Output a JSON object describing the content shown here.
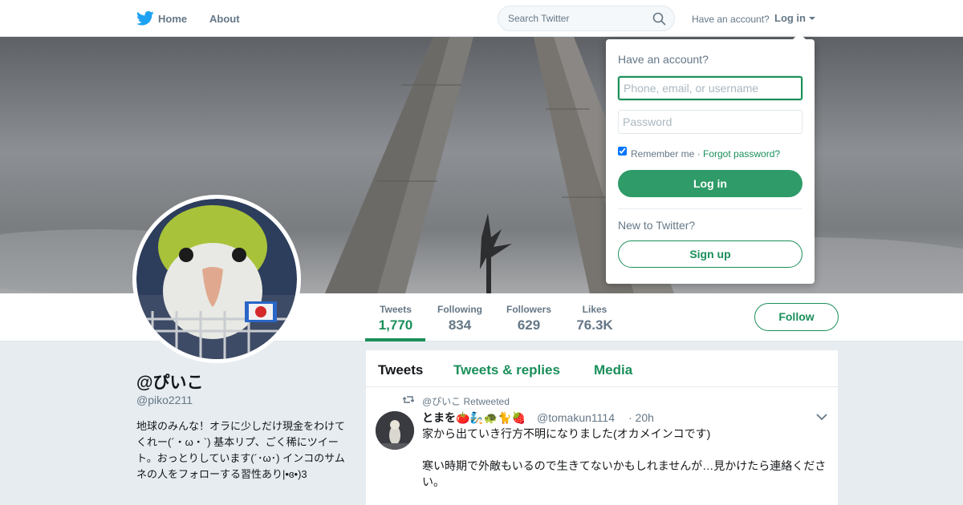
{
  "nav": {
    "home": "Home",
    "about": "About",
    "search_placeholder": "Search Twitter",
    "have_account": "Have an account?",
    "login": "Log in"
  },
  "profile": {
    "name": "@ぴいこ",
    "handle": "@piko2211",
    "bio": "地球のみんな！オラに少しだけ現金をわけてくれー(´・ω・`) 基本リプ、ごく稀にツイート。おっとりしています(´･ω･) インコのサムネの人をフォローする習性あり|•ɞ•)3"
  },
  "stats": [
    {
      "label": "Tweets",
      "value": "1,770",
      "active": true
    },
    {
      "label": "Following",
      "value": "834",
      "active": false
    },
    {
      "label": "Followers",
      "value": "629",
      "active": false
    },
    {
      "label": "Likes",
      "value": "76.3K",
      "active": false
    }
  ],
  "follow_label": "Follow",
  "tabs": [
    "Tweets",
    "Tweets & replies",
    "Media"
  ],
  "tweet": {
    "retweeted_by": "@ぴいこ Retweeted",
    "name": "とまを🍅🧞🐢🐈🍓",
    "handle": "@tomakun1114",
    "time": "· 20h",
    "text_1": "家から出ていき行方不明になりました(オカメインコです)",
    "text_2": "寒い時期で外敵もいるので生きてないかもしれませんが…見かけたら連絡ください。"
  },
  "login_dropdown": {
    "title": "Have an account?",
    "username_placeholder": "Phone, email, or username",
    "password_placeholder": "Password",
    "remember": "Remember me",
    "forgot": "Forgot password?",
    "login_button": "Log in",
    "new_to_twitter": "New to Twitter?",
    "signup_button": "Sign up",
    "remember_checked": true
  },
  "colors": {
    "accent": "#1b8f5a",
    "brand_bird": "#1da1f2",
    "text_muted": "#657786"
  }
}
